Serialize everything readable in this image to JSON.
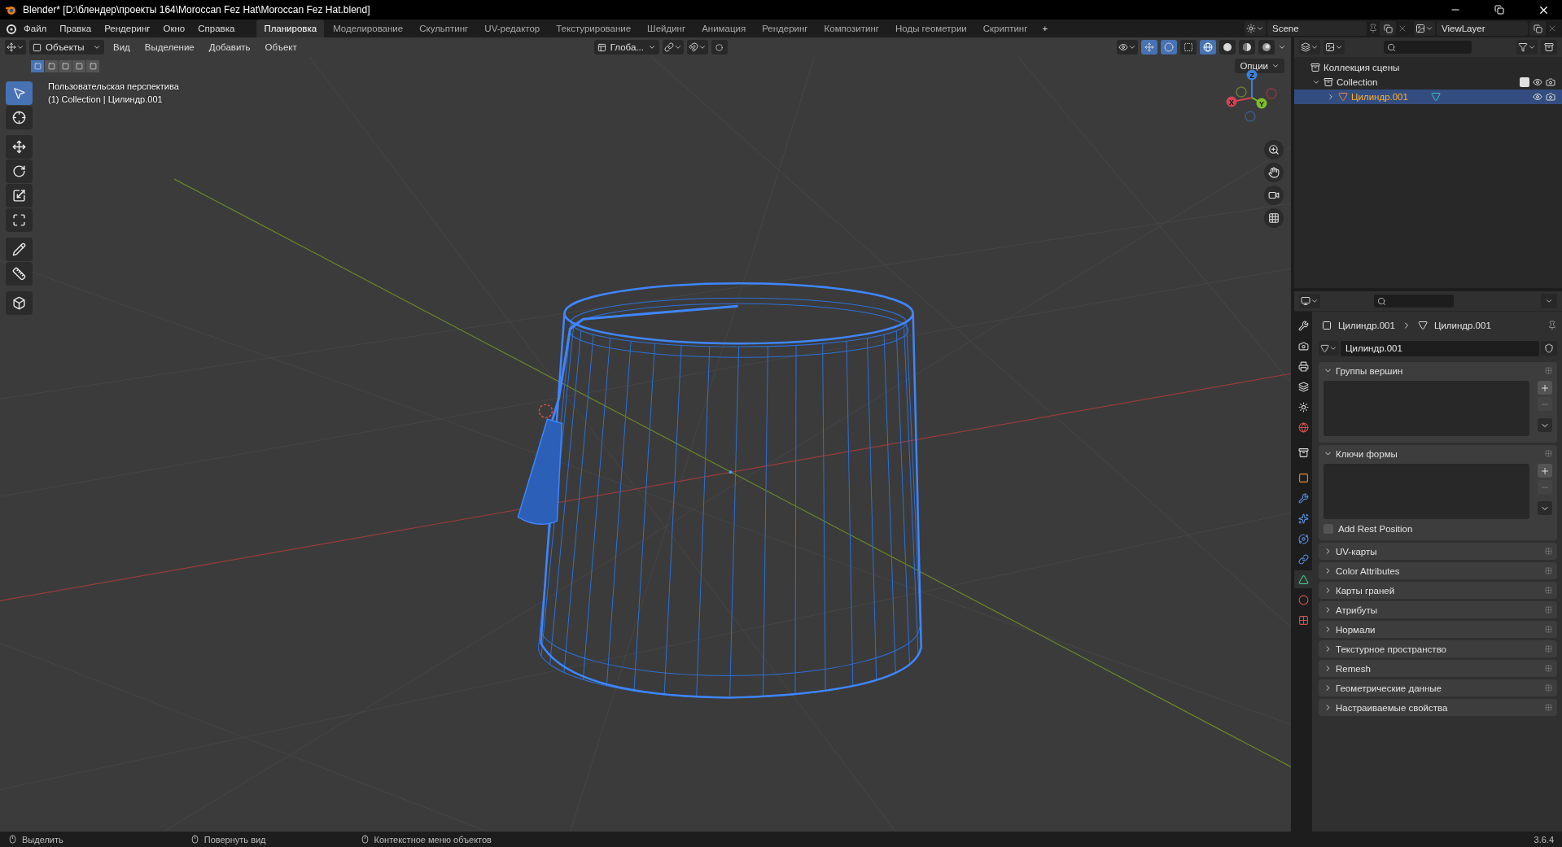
{
  "window": {
    "title": "Blender* [D:\\блендер\\проекты 164\\Moroccan Fez Hat\\Moroccan Fez Hat.blend]"
  },
  "menu": [
    "Файл",
    "Правка",
    "Рендеринг",
    "Окно",
    "Справка"
  ],
  "workspaces": [
    {
      "label": "Планировка",
      "selected": true
    },
    {
      "label": "Моделирование",
      "selected": false
    },
    {
      "label": "Скульптинг",
      "selected": false
    },
    {
      "label": "UV-редактор",
      "selected": false
    },
    {
      "label": "Текстурирование",
      "selected": false
    },
    {
      "label": "Шейдинг",
      "selected": false
    },
    {
      "label": "Анимация",
      "selected": false
    },
    {
      "label": "Рендеринг",
      "selected": false
    },
    {
      "label": "Композитинг",
      "selected": false
    },
    {
      "label": "Ноды геометрии",
      "selected": false
    },
    {
      "label": "Скриптинг",
      "selected": false
    }
  ],
  "add_workspace": "+",
  "scene": "Scene",
  "view_layer": "ViewLayer",
  "viewport": {
    "mode": "Объекты",
    "menus": [
      "Вид",
      "Выделение",
      "Добавить",
      "Объект"
    ],
    "orientation": "Глоба...",
    "options": "Опции",
    "select_modes": [
      {
        "selected": true
      },
      {
        "selected": false
      },
      {
        "selected": false
      },
      {
        "selected": false
      },
      {
        "selected": false
      }
    ],
    "shading": [
      {
        "kind": "wireframe",
        "selected": true
      },
      {
        "kind": "solid",
        "selected": false
      },
      {
        "kind": "material",
        "selected": false
      },
      {
        "kind": "rendered",
        "selected": false
      }
    ],
    "overlay_lines": [
      "Пользовательская перспектива",
      "(1) Collection | Цилиндр.001"
    ],
    "tools": [
      {
        "kind": "select",
        "selected": true
      },
      {
        "kind": "cursor",
        "selected": false
      },
      {
        "kind": "move",
        "selected": false
      },
      {
        "kind": "rotate",
        "selected": false
      },
      {
        "kind": "scale",
        "selected": false
      },
      {
        "kind": "transform",
        "selected": false
      },
      {
        "kind": "annotate",
        "selected": false
      },
      {
        "kind": "measure",
        "selected": false
      },
      {
        "kind": "add_cube",
        "selected": false
      }
    ],
    "gizmo_axes": [
      "X",
      "Y",
      "Z"
    ]
  },
  "outliner": {
    "items": [
      {
        "label": "Коллекция сцены",
        "children": [
          {
            "label": "Collection",
            "expanded": true,
            "checked": true,
            "children": [
              {
                "label": "Цилиндр.001",
                "selected": true,
                "expanded": false
              }
            ]
          }
        ]
      }
    ]
  },
  "properties": {
    "breadcrumb": [
      "Цилиндр.001",
      "Цилиндр.001"
    ],
    "data_name": "Цилиндр.001",
    "tabs": [
      {
        "kind": "tool",
        "selected": false
      },
      {
        "kind": "render",
        "selected": false
      },
      {
        "kind": "output",
        "selected": false
      },
      {
        "kind": "view_layer",
        "selected": false
      },
      {
        "kind": "scene",
        "selected": false
      },
      {
        "kind": "world",
        "selected": false
      },
      {
        "kind": "collection",
        "selected": false
      },
      {
        "kind": "object",
        "selected": false
      },
      {
        "kind": "modifiers",
        "selected": false
      },
      {
        "kind": "particles",
        "selected": false
      },
      {
        "kind": "physics",
        "selected": false
      },
      {
        "kind": "constraints",
        "selected": false
      },
      {
        "kind": "data",
        "selected": true
      },
      {
        "kind": "material",
        "selected": false
      },
      {
        "kind": "texture",
        "selected": false
      }
    ],
    "panels": [
      {
        "title": "Группы вершин",
        "expanded": true
      },
      {
        "title": "Ключи формы",
        "expanded": true,
        "checkbox": {
          "label": "Add Rest Position",
          "checked": false
        }
      },
      {
        "title": "UV-карты",
        "expanded": false
      },
      {
        "title": "Color Attributes",
        "expanded": false
      },
      {
        "title": "Карты граней",
        "expanded": false
      },
      {
        "title": "Атрибуты",
        "expanded": false
      },
      {
        "title": "Нормали",
        "expanded": false
      },
      {
        "title": "Текстурное пространство",
        "expanded": false
      },
      {
        "title": "Remesh",
        "expanded": false
      },
      {
        "title": "Геометрические данные",
        "expanded": false
      },
      {
        "title": "Настраиваемые свойства",
        "expanded": false
      }
    ]
  },
  "status_bar": {
    "hints": [
      "Выделить",
      "Повернуть вид",
      "Контекстное меню объектов"
    ],
    "version": "3.6.4"
  }
}
